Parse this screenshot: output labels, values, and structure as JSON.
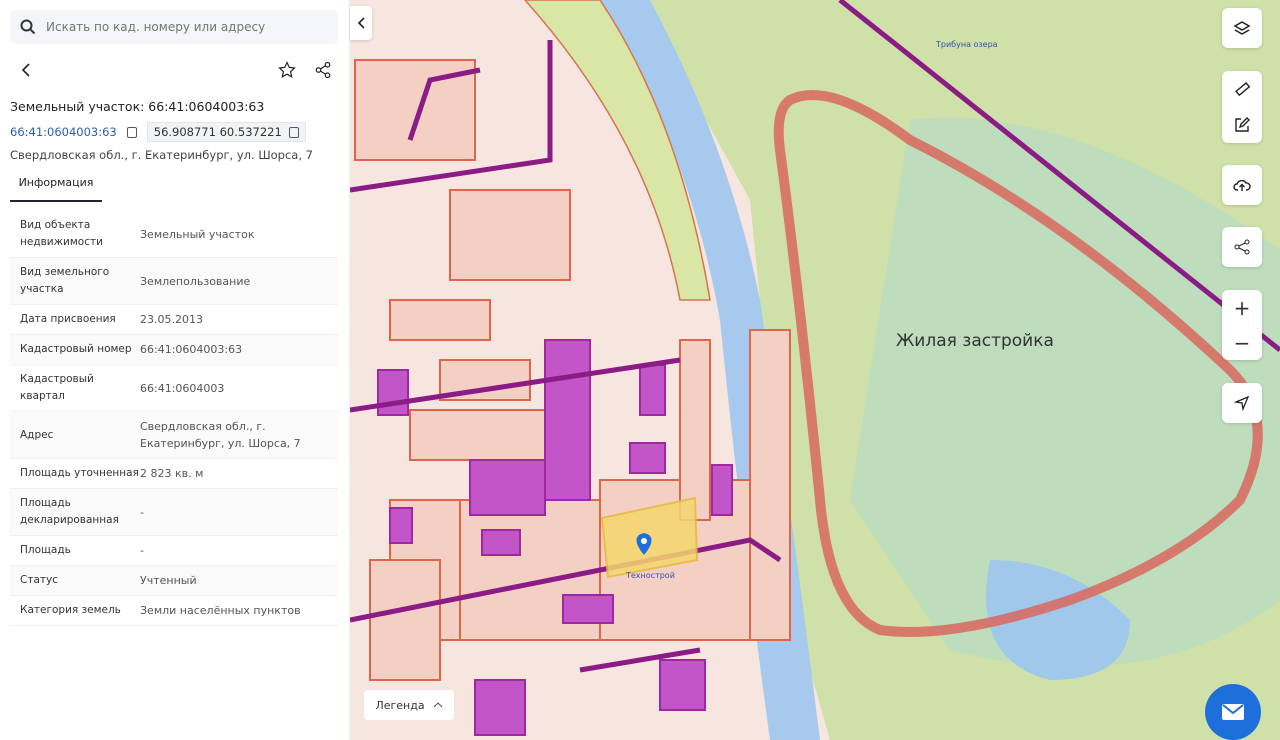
{
  "search": {
    "placeholder": "Искать по кад. номеру или адресу"
  },
  "object": {
    "title": "Земельный участок: 66:41:0604003:63",
    "cadastral_number": "66:41:0604003:63",
    "coordinates": "56.908771 60.537221",
    "address": "Свердловская обл., г. Екатеринбург, ул. Шорса, 7"
  },
  "tabs": [
    {
      "label": "Информация"
    }
  ],
  "info_rows": [
    {
      "key": "Вид объекта недвижимости",
      "value": "Земельный участок"
    },
    {
      "key": "Вид земельного участка",
      "value": "Землепользование"
    },
    {
      "key": "Дата присвоения",
      "value": "23.05.2013"
    },
    {
      "key": "Кадастровый номер",
      "value": "66:41:0604003:63"
    },
    {
      "key": "Кадастровый квартал",
      "value": "66:41:0604003"
    },
    {
      "key": "Адрес",
      "value": "Свердловская обл., г. Екатеринбург, ул. Шорса, 7"
    },
    {
      "key": "Площадь уточненная",
      "value": "2 823 кв. м"
    },
    {
      "key": "Площадь декларированная",
      "value": "-"
    },
    {
      "key": "Площадь",
      "value": "-"
    },
    {
      "key": "Статус",
      "value": "Учтенный"
    },
    {
      "key": "Категория земель",
      "value": "Земли населённых пунктов"
    }
  ],
  "map": {
    "zone_label": "Жилая застройка",
    "poi_top": "Трибуна озера",
    "poi_marker": "Технострой",
    "legend_label": "Легенда",
    "zoom_in": "+",
    "zoom_out": "−"
  },
  "colors": {
    "accent": "#1e6fd9",
    "parcel": "#f5d76e",
    "zone_outline": "#d9675e",
    "buildings": "#c255c8"
  }
}
